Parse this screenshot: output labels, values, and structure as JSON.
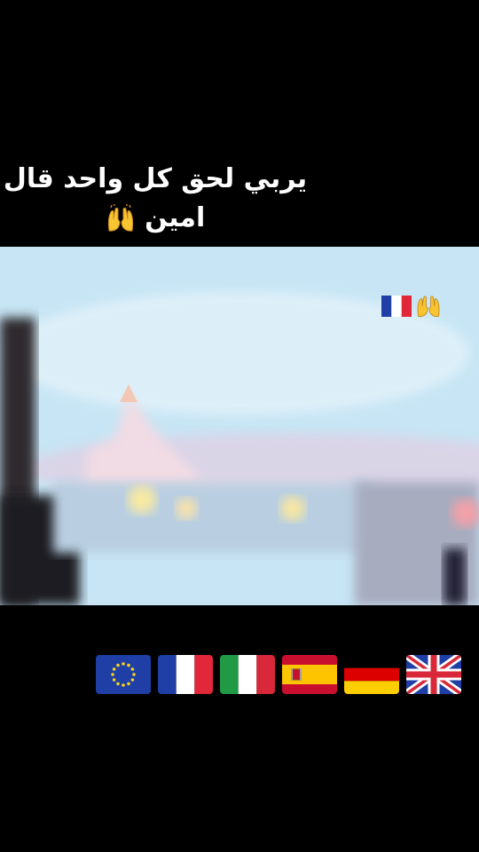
{
  "caption": {
    "line1": "يربي لحق كل واحد قال",
    "line2": "امين"
  },
  "icons": {
    "caption_emoji": "raising-hands-icon",
    "overlay": [
      "france-flag-icon",
      "raising-hands-icon"
    ],
    "flags": [
      "eu-flag-icon",
      "france-flag-icon",
      "italy-flag-icon",
      "spain-flag-icon",
      "germany-flag-icon",
      "uk-flag-icon"
    ]
  },
  "colors": {
    "background": "#000000",
    "sky": "#cfeaf7",
    "emoji_yellow": "#f7c531"
  }
}
